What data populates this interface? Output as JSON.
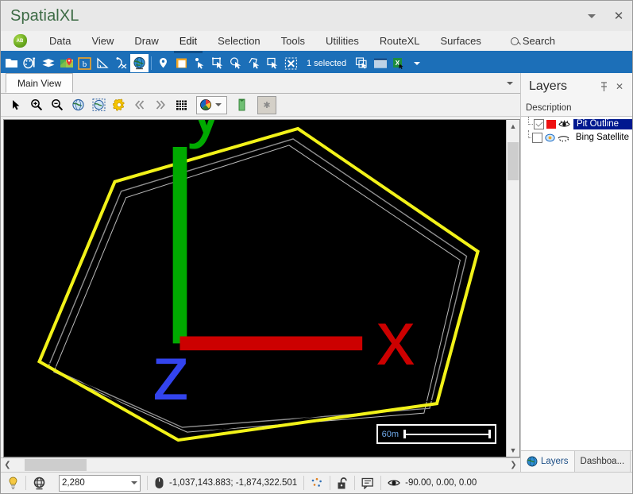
{
  "window": {
    "title": "SpatialXL",
    "minimize_icon": "chevron-down-icon",
    "close_icon": "close-icon"
  },
  "menubar": {
    "logo": "app-logo-icon",
    "items": [
      {
        "label": "Data",
        "active": false
      },
      {
        "label": "View",
        "active": false
      },
      {
        "label": "Draw",
        "active": false
      },
      {
        "label": "Edit",
        "active": true
      },
      {
        "label": "Selection",
        "active": false
      },
      {
        "label": "Tools",
        "active": false
      },
      {
        "label": "Utilities",
        "active": false
      },
      {
        "label": "RouteXL",
        "active": false
      },
      {
        "label": "Surfaces",
        "active": false
      }
    ],
    "search_label": "Search",
    "search_icon": "search-icon"
  },
  "ribbon": {
    "selection_label": "1 selected",
    "overflow_icon": "chevron-down-icon",
    "buttons": [
      {
        "name": "open-folder-icon",
        "selected": false
      },
      {
        "name": "palette-settings-icon",
        "selected": false
      },
      {
        "name": "layers-stack-icon",
        "selected": false
      },
      {
        "name": "map-pin-icon",
        "selected": false
      },
      {
        "name": "bing-maps-icon",
        "selected": false
      },
      {
        "name": "measure-angle-icon",
        "selected": false
      },
      {
        "name": "snap-vertex-icon",
        "selected": false
      },
      {
        "name": "globe-icon",
        "selected": true
      },
      {
        "name": "location-marker-icon",
        "selected": false
      },
      {
        "name": "digitize-window-icon",
        "selected": false
      },
      {
        "name": "select-point-icon",
        "selected": false
      },
      {
        "name": "select-rectangle-icon",
        "selected": false
      },
      {
        "name": "select-circle-icon",
        "selected": false
      },
      {
        "name": "select-polygon-icon",
        "selected": false
      },
      {
        "name": "select-inside-icon",
        "selected": false
      },
      {
        "name": "clear-selection-icon",
        "selected": false
      },
      {
        "name": "copy-selection-icon",
        "selected": false
      },
      {
        "name": "attribute-table-icon",
        "selected": false
      },
      {
        "name": "export-excel-icon",
        "selected": false
      }
    ]
  },
  "view": {
    "tab_label": "Main View",
    "tab_overflow_icon": "chevron-down-icon",
    "toolbar": [
      {
        "name": "pointer-arrow-icon"
      },
      {
        "name": "zoom-in-icon"
      },
      {
        "name": "zoom-out-icon"
      },
      {
        "name": "zoom-extents-icon"
      },
      {
        "name": "zoom-selected-icon"
      },
      {
        "name": "view-settings-gear-icon"
      },
      {
        "name": "previous-view-icon"
      },
      {
        "name": "next-view-icon"
      },
      {
        "name": "grid-toggle-icon"
      },
      {
        "name": "colour-legend-icon"
      },
      {
        "name": "bookmark-flag-icon"
      },
      {
        "name": "snapshot-icon"
      }
    ]
  },
  "canvas": {
    "background_color": "#000000",
    "scalebar": {
      "label": "60m"
    },
    "axis_triad": {
      "x_label": "x",
      "y_label": "y",
      "z_label": "z",
      "x_color": "#cc0000",
      "y_color": "#00aa00",
      "z_color": "#2222dd"
    },
    "outline_colors": {
      "selected": "#f2f219",
      "inner_primary": "#808080",
      "inner_secondary": "#c8c8c8"
    }
  },
  "layers_panel": {
    "title": "Layers",
    "pin_icon": "pin-icon",
    "close_icon": "close-icon",
    "column_header": "Description",
    "rows": [
      {
        "name": "Pit Outline",
        "checked": true,
        "selected": true,
        "swatch": "#ee1111",
        "visibility_icon": "eye-visible-icon"
      },
      {
        "name": "Bing Satellite",
        "checked": false,
        "selected": false,
        "swatch": "image-layer-icon",
        "visibility_icon": "eye-hidden-icon"
      }
    ],
    "tabs": [
      {
        "label": "Layers",
        "icon": "globe-icon",
        "active": true
      },
      {
        "label": "Dashboa...",
        "icon": "",
        "active": false
      }
    ]
  },
  "statusbar": {
    "hint_icon": "lightbulb-icon",
    "projection_icon": "globe-wire-icon",
    "scale_value": "2,280",
    "scale_caret": "chevron-down-icon",
    "cursor_icon": "mouse-icon",
    "coordinates": "-1,037,143.883; -1,874,322.501",
    "snap_icon": "snap-points-icon",
    "lock_icon": "unlocked-icon",
    "annotation_icon": "label-icon",
    "eye_icon": "eye-visible-icon",
    "orientation": "-90.00, 0.00, 0.00"
  }
}
